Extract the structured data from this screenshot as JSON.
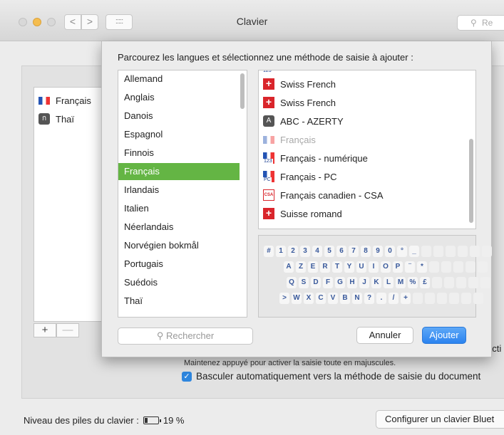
{
  "window": {
    "title": "Clavier",
    "search_placeholder": "Re",
    "nav_back": "<",
    "nav_forward": ">",
    "grid": ":::::"
  },
  "background": {
    "input_sources": [
      {
        "label": "Français",
        "icon": "french-flag-icon"
      },
      {
        "label": "Thaï",
        "icon": "thai-script-icon"
      }
    ],
    "add_label": "+",
    "remove_label": "—",
    "truncated_label": "acti",
    "caps_hint": "Maintenez appuyé pour activer la saisie toute en majuscules.",
    "auto_switch_label": "Basculer automatiquement vers la méthode de saisie du document",
    "auto_switch_checked": true,
    "battery_label": "Niveau des piles du clavier :",
    "battery_percent": "19 %",
    "battery_level": 0.19,
    "bluetooth_button": "Configurer un clavier Bluet"
  },
  "sheet": {
    "prompt": "Parcourez les langues et sélectionnez une méthode de saisie à ajouter :",
    "languages": [
      "Allemand",
      "Anglais",
      "Danois",
      "Espagnol",
      "Finnois",
      "Français",
      "Irlandais",
      "Italien",
      "Néerlandais",
      "Norvégien bokmål",
      "Portugais",
      "Suédois",
      "Thaï"
    ],
    "selected_language": "Français",
    "methods": [
      {
        "label": "Swiss French",
        "icon": "swiss-flag-icon",
        "disabled": false
      },
      {
        "label": "Swiss French",
        "icon": "swiss-flag-icon",
        "disabled": false
      },
      {
        "label": "ABC - AZERTY",
        "icon": "letter-a-icon",
        "icon_text": "A",
        "disabled": false
      },
      {
        "label": "Français",
        "icon": "french-flag-icon",
        "disabled": true
      },
      {
        "label": "Français - numérique",
        "icon": "french-numeric-icon",
        "icon_text": "123",
        "disabled": false
      },
      {
        "label": "Français - PC",
        "icon": "french-pc-icon",
        "icon_text": "PC",
        "disabled": false
      },
      {
        "label": "Français canadien - CSA",
        "icon": "canadian-csa-icon",
        "icon_text": "CSA",
        "disabled": false
      },
      {
        "label": "Suisse romand",
        "icon": "swiss-flag-icon",
        "disabled": false
      }
    ],
    "method_top_partial": "123",
    "keyboard_rows": [
      [
        "#",
        "1",
        "2",
        "3",
        "4",
        "5",
        "6",
        "7",
        "8",
        "9",
        "0",
        "°",
        "_"
      ],
      [
        "A",
        "Z",
        "E",
        "R",
        "T",
        "Y",
        "U",
        "I",
        "O",
        "P",
        "¨",
        "*"
      ],
      [
        "Q",
        "S",
        "D",
        "F",
        "G",
        "H",
        "J",
        "K",
        "L",
        "M",
        "%",
        "£"
      ],
      [
        ">",
        "W",
        "X",
        "C",
        "V",
        "B",
        "N",
        "?",
        ".",
        "/",
        "+"
      ]
    ],
    "search_placeholder": "Rechercher",
    "cancel_label": "Annuler",
    "add_label": "Ajouter"
  }
}
